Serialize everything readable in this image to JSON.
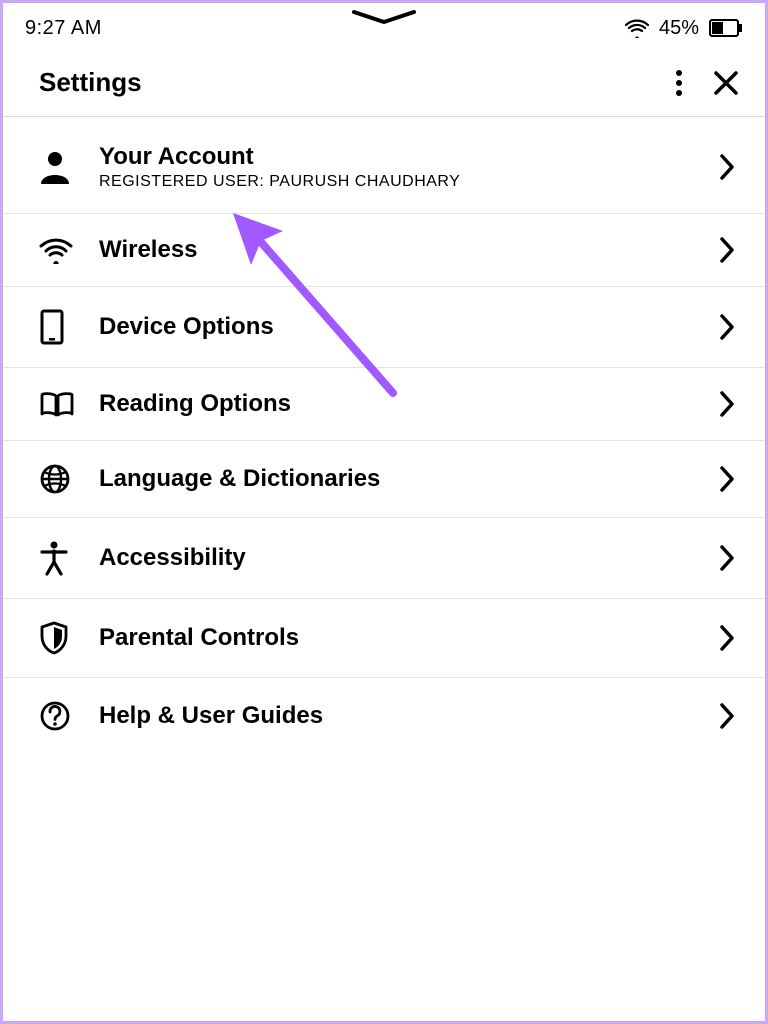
{
  "statusbar": {
    "time": "9:27 AM",
    "battery_percent": "45%"
  },
  "header": {
    "title": "Settings"
  },
  "rows": {
    "account": {
      "label": "Your Account",
      "sub": "REGISTERED USER: PAURUSH CHAUDHARY"
    },
    "wireless": {
      "label": "Wireless"
    },
    "device": {
      "label": "Device Options"
    },
    "reading": {
      "label": "Reading Options"
    },
    "language": {
      "label": "Language & Dictionaries"
    },
    "accessibility": {
      "label": "Accessibility"
    },
    "parental": {
      "label": "Parental Controls"
    },
    "help": {
      "label": "Help & User Guides"
    }
  }
}
